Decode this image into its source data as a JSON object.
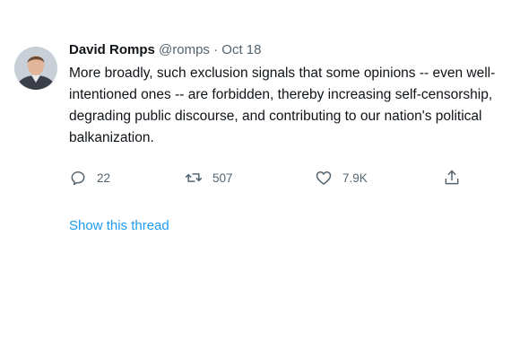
{
  "tweet": {
    "author_name": "David Romps",
    "handle": "@romps",
    "separator": "·",
    "timestamp": "Oct 18",
    "text": "More broadly, such exclusion signals that some opinions -- even well-intentioned ones -- are forbidden, thereby increasing self-censorship, degrading public discourse, and contributing to our nation's political balkanization.",
    "actions": {
      "reply": {
        "icon": "reply-icon",
        "count": "22"
      },
      "retweet": {
        "icon": "retweet-icon",
        "count": "507"
      },
      "like": {
        "icon": "heart-icon",
        "count": "7.9K"
      },
      "share": {
        "icon": "share-icon"
      }
    },
    "show_thread_label": "Show this thread"
  },
  "colors": {
    "text_primary": "#0f1419",
    "text_secondary": "#536471",
    "link": "#1d9bf0"
  }
}
